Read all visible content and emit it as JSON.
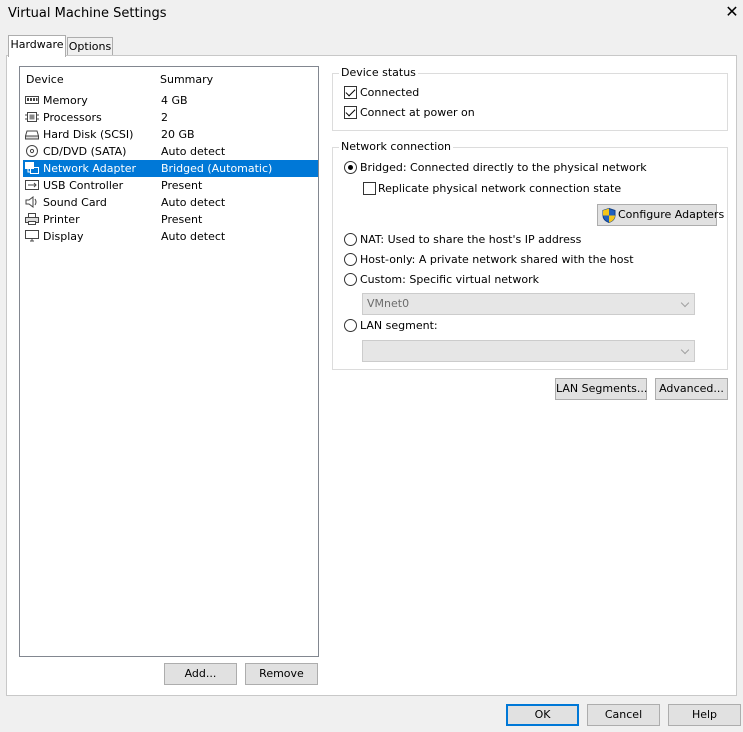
{
  "window": {
    "title": "Virtual Machine Settings",
    "close_glyph": "✕"
  },
  "tabs": [
    {
      "label": "Hardware"
    },
    {
      "label": "Options"
    }
  ],
  "device_list": {
    "columns": {
      "device": "Device",
      "summary": "Summary"
    },
    "rows": [
      {
        "name": "Memory",
        "summary": "4 GB",
        "icon": "memory-icon"
      },
      {
        "name": "Processors",
        "summary": "2",
        "icon": "processor-icon"
      },
      {
        "name": "Hard Disk (SCSI)",
        "summary": "20 GB",
        "icon": "hard-disk-icon"
      },
      {
        "name": "CD/DVD (SATA)",
        "summary": "Auto detect",
        "icon": "cd-dvd-icon"
      },
      {
        "name": "Network Adapter",
        "summary": "Bridged (Automatic)",
        "icon": "network-adapter-icon",
        "selected": true
      },
      {
        "name": "USB Controller",
        "summary": "Present",
        "icon": "usb-icon"
      },
      {
        "name": "Sound Card",
        "summary": "Auto detect",
        "icon": "speaker-icon"
      },
      {
        "name": "Printer",
        "summary": "Present",
        "icon": "printer-icon"
      },
      {
        "name": "Display",
        "summary": "Auto detect",
        "icon": "display-icon"
      }
    ],
    "add_label": "Add...",
    "remove_label": "Remove"
  },
  "device_status": {
    "title": "Device status",
    "connected_label": "Connected",
    "connected": true,
    "connect_power_on_label": "Connect at power on",
    "connect_power_on": true
  },
  "network_connection": {
    "title": "Network connection",
    "bridged_label": "Bridged: Connected directly to the physical network",
    "replicate_label": "Replicate physical network connection state",
    "replicate": false,
    "configure_adapters_label": "Configure Adapters",
    "nat_label": "NAT: Used to share the host's IP address",
    "host_only_label": "Host-only: A private network shared with the host",
    "custom_label": "Custom: Specific virtual network",
    "custom_value": "VMnet0",
    "lan_segment_label": "LAN segment:",
    "lan_segment_value": "",
    "selected": "bridged"
  },
  "extra_buttons": {
    "lan_segments": "LAN Segments...",
    "advanced": "Advanced..."
  },
  "footer": {
    "ok": "OK",
    "cancel": "Cancel",
    "help": "Help"
  },
  "colors": {
    "selection": "#0078d7",
    "shield_blue": "#1f5fbf",
    "shield_yellow": "#f5c518"
  }
}
